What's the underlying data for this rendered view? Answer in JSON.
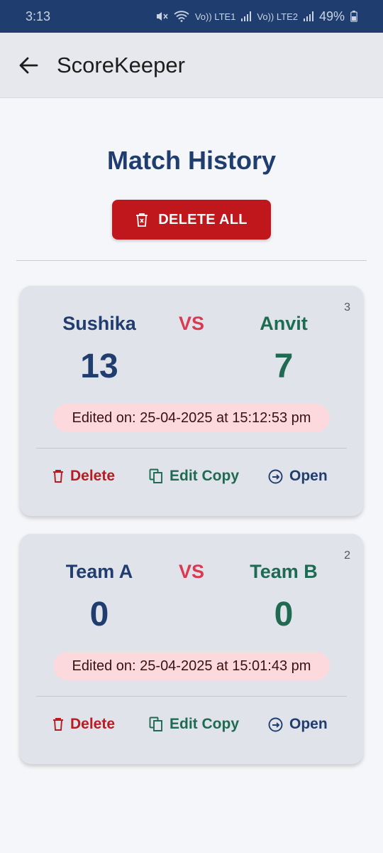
{
  "status_bar": {
    "time": "3:13",
    "network_1": "Vo)) LTE1",
    "network_2": "Vo)) LTE2",
    "battery": "49%"
  },
  "app_bar": {
    "title": "ScoreKeeper"
  },
  "page": {
    "title": "Match History",
    "delete_all_label": "DELETE ALL"
  },
  "matches": [
    {
      "id": "3",
      "team_a": "Sushika",
      "team_b": "Anvit",
      "vs": "VS",
      "score_a": "13",
      "score_b": "7",
      "edited": "Edited on: 25-04-2025 at 15:12:53 pm",
      "delete_label": "Delete",
      "edit_copy_label": "Edit Copy",
      "open_label": "Open"
    },
    {
      "id": "2",
      "team_a": "Team A",
      "team_b": "Team B",
      "vs": "VS",
      "score_a": "0",
      "score_b": "0",
      "edited": "Edited on: 25-04-2025 at 15:01:43 pm",
      "delete_label": "Delete",
      "edit_copy_label": "Edit Copy",
      "open_label": "Open"
    }
  ],
  "colors": {
    "primary": "#1f3d6e",
    "danger": "#c0171c",
    "green": "#1e6b52",
    "vs": "#d93a4f"
  }
}
